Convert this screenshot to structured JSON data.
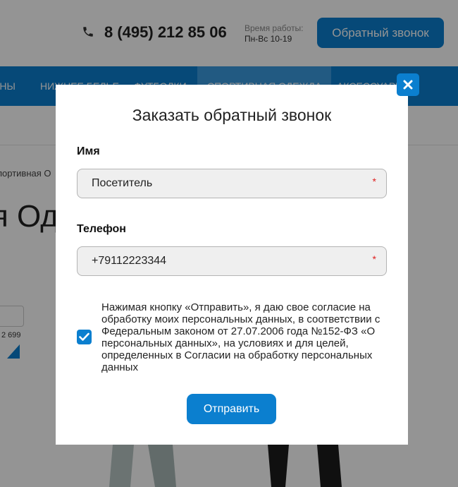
{
  "header": {
    "phone": "8 (495) 212 85 06",
    "hours_label": "Время работы:",
    "hours_value": "Пн-Вс 10-19",
    "callback_button": "Обратный звонок"
  },
  "nav": {
    "items": [
      "АНЫ",
      "НИЖНЕЕ БЕЛЬЕ",
      "ФУТБОЛКИ",
      "СПОРТИВНАЯ ОДЕЖДА",
      "АКСЕССУАРЫ"
    ]
  },
  "background": {
    "breadcrumb": "портивная О",
    "page_title": "я Од",
    "price_value": "2 699"
  },
  "modal": {
    "title": "Заказать обратный звонок",
    "name_label": "Имя",
    "name_value": "Посетитель",
    "phone_label": "Телефон",
    "phone_value": "+79112223344",
    "required_mark": "*",
    "consent_checked": true,
    "consent_text": "Нажимая кнопку «Отправить», я даю свое согласие на обработку моих персональных данных, в соответствии с Федеральным законом от 27.07.2006 года №152-ФЗ «О персональных данных», на условиях и для целей, определенных в Согласии на обработку персональных данных",
    "submit_label": "Отправить"
  },
  "colors": {
    "accent": "#0b7fcf",
    "required": "#e02020",
    "overlay": "rgba(0,0,0,0.42)"
  },
  "icons": [
    "phone-icon",
    "close-icon",
    "checkmark-icon"
  ]
}
